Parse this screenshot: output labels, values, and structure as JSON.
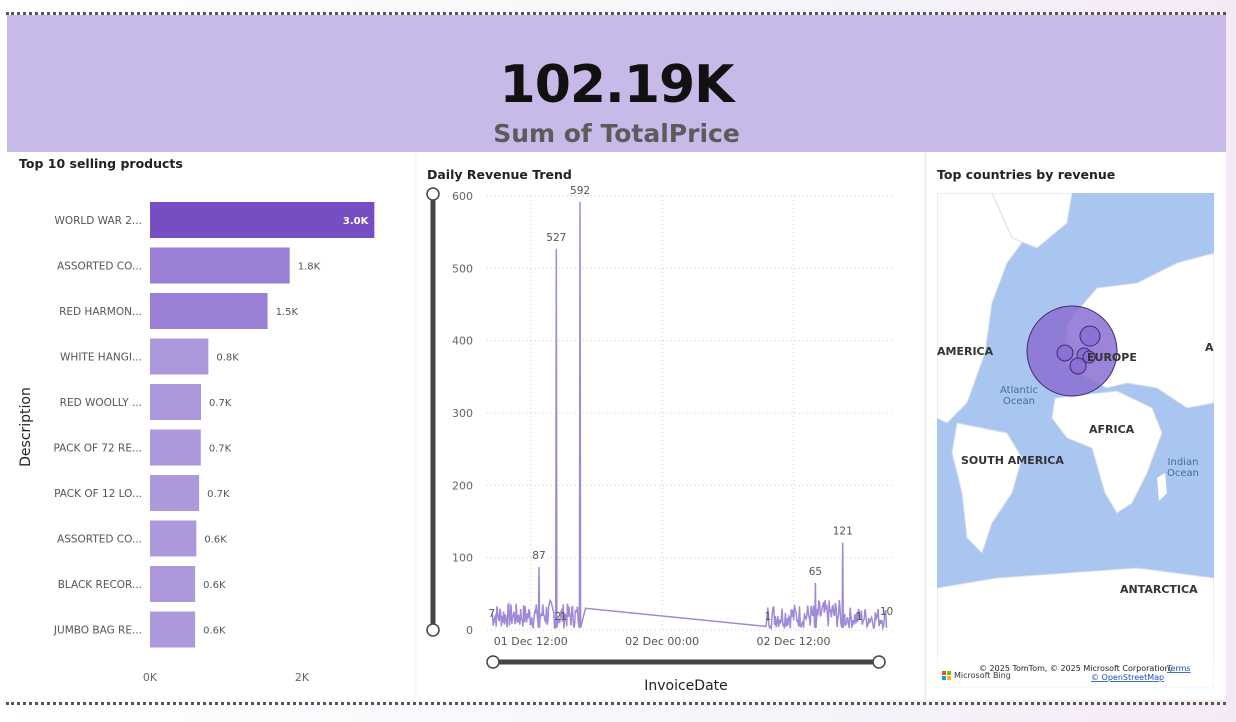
{
  "kpi": {
    "value": "102.19K",
    "label": "Sum of TotalPrice"
  },
  "bar_panel": {
    "title": "Top 10 selling products",
    "y_axis_title": "Description",
    "x_ticks": [
      "0K",
      "2K"
    ]
  },
  "line_panel": {
    "title": "Daily Revenue Trend",
    "x_axis_title": "InvoiceDate",
    "y_ticks": [
      "600",
      "500",
      "400",
      "300",
      "200",
      "100",
      "0"
    ],
    "x_ticks": [
      "01 Dec 12:00",
      "02 Dec 00:00",
      "02 Dec 12:00"
    ]
  },
  "map_panel": {
    "title": "Top countries by revenue",
    "labels": {
      "america": "AMERICA",
      "europe": "EUROPE",
      "atlantic": "Atlantic\nOcean",
      "africa": "AFRICA",
      "south_america": "SOUTH AMERICA",
      "indian": "Indian\nOcean",
      "antarctica": "ANTARCTICA",
      "as": "AS"
    },
    "attribution": "© 2025 TomTom, © 2025 Microsoft Corporation,",
    "terms": "Terms",
    "osm": "© OpenStreetMap",
    "bing": "Microsoft Bing"
  },
  "colors": {
    "kpi_bg": "#c7b9e8",
    "bar_top": "#744ec2",
    "bar_mid": "#9a7fd6",
    "bar_low": "#ad98dc",
    "line": "#a08ad8",
    "map_water": "#a9c6f0",
    "map_land": "#ffffff",
    "bubble": "#8a6fd2"
  },
  "chart_data": [
    {
      "type": "bar",
      "title": "Top 10 selling products",
      "ylabel": "Description",
      "xlabel": "",
      "orientation": "horizontal",
      "categories": [
        "WORLD WAR 2...",
        "ASSORTED CO...",
        "RED HARMON...",
        "WHITE HANGI...",
        "RED WOOLLY ...",
        "PACK OF 72 RE...",
        "PACK OF 12 LO...",
        "ASSORTED CO...",
        "BLACK RECOR...",
        "JUMBO BAG RE..."
      ],
      "values": [
        2952,
        1838,
        1547,
        768,
        671,
        668,
        646,
        610,
        594,
        594
      ],
      "data_labels": [
        "3.0K",
        "1.8K",
        "1.5K",
        "0.8K",
        "0.7K",
        "0.7K",
        "0.7K",
        "0.6K",
        "0.6K",
        "0.6K"
      ],
      "xlim": [
        0,
        3000
      ]
    },
    {
      "type": "line",
      "title": "Daily Revenue Trend",
      "xlabel": "InvoiceDate",
      "ylabel": "",
      "ylim": [
        0,
        600
      ],
      "x_range": [
        "2010-12-01 08:00",
        "2010-12-02 21:00"
      ],
      "annotated_points": [
        {
          "x": "2010-12-01 08:26",
          "y": 7,
          "label": "7"
        },
        {
          "x": "2010-12-01 12:45",
          "y": 87,
          "label": "87"
        },
        {
          "x": "2010-12-01 14:20",
          "y": 527,
          "label": "527"
        },
        {
          "x": "2010-12-01 14:30",
          "y": 2,
          "label": "2"
        },
        {
          "x": "2010-12-01 15:00",
          "y": 1,
          "label": "1"
        },
        {
          "x": "2010-12-01 16:30",
          "y": 592,
          "label": "592"
        },
        {
          "x": "2010-12-02 09:40",
          "y": 1,
          "label": "1"
        },
        {
          "x": "2010-12-02 14:00",
          "y": 65,
          "label": "65"
        },
        {
          "x": "2010-12-02 16:30",
          "y": 121,
          "label": "121"
        },
        {
          "x": "2010-12-02 18:00",
          "y": 1,
          "label": "1"
        },
        {
          "x": "2010-12-02 20:30",
          "y": 10,
          "label": "10"
        }
      ]
    }
  ]
}
